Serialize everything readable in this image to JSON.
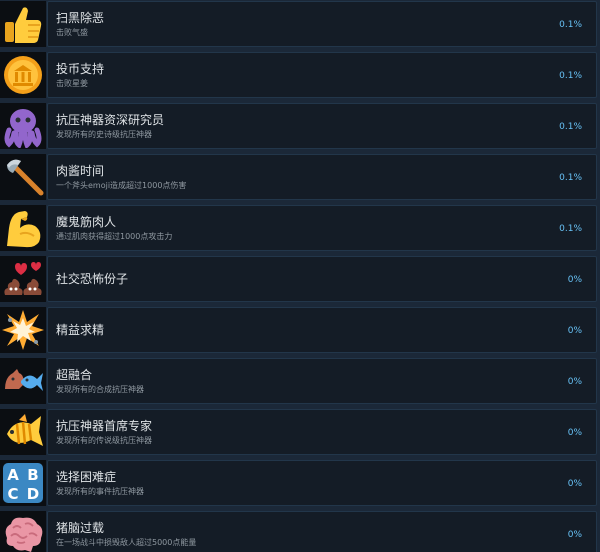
{
  "achievements": [
    {
      "icon": "thumbs-up-icon",
      "title": "扫黑除恶",
      "desc": "击败气盛",
      "pct": "0.1%"
    },
    {
      "icon": "coin-icon",
      "title": "投币支持",
      "desc": "击败星姜",
      "pct": "0.1%"
    },
    {
      "icon": "octopus-icon",
      "title": "抗压神器资深研究员",
      "desc": "发现所有的史诗级抗压神器",
      "pct": "0.1%"
    },
    {
      "icon": "axe-icon",
      "title": "肉酱时间",
      "desc": "一个斧头emoji造成超过1000点伤害",
      "pct": "0.1%"
    },
    {
      "icon": "flexed-biceps-icon",
      "title": "魔鬼筋肉人",
      "desc": "通过肌肉获得超过1000点攻击力",
      "pct": "0.1%"
    },
    {
      "icon": "poop-hearts-icon",
      "title": "社交恐怖份子",
      "desc": "",
      "pct": "0%"
    },
    {
      "icon": "collision-icon",
      "title": "精益求精",
      "desc": "",
      "pct": "0%"
    },
    {
      "icon": "horse-fish-icon",
      "title": "超融合",
      "desc": "发现所有的合成抗压神器",
      "pct": "0%"
    },
    {
      "icon": "tropical-fish-icon",
      "title": "抗压神器首席专家",
      "desc": "发现所有的传说级抗压神器",
      "pct": "0%"
    },
    {
      "icon": "abcd-icon",
      "title": "选择困难症",
      "desc": "发现所有的事件抗压神器",
      "pct": "0%"
    },
    {
      "icon": "brain-icon",
      "title": "猪脑过载",
      "desc": "在一场战斗中损毁敌人超过5000点能量",
      "pct": "0%"
    }
  ]
}
